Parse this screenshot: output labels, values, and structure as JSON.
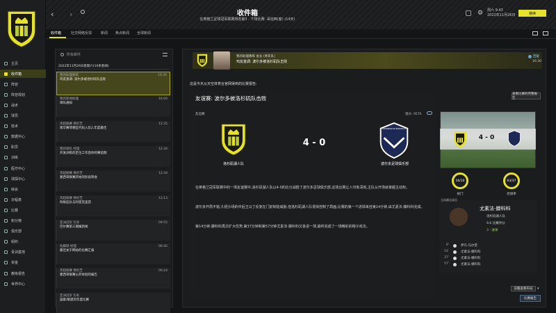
{
  "colors": {
    "accent": "#e6e22b",
    "bg": "#141516",
    "panel": "#1b1c1d"
  },
  "header": {
    "title": "收件箱",
    "subtitle": "在英格兰足球冠军联赛排名第3 - 下场比赛: 哥廷西(客) (14天)",
    "date_line1": "周六 9:43",
    "date_line2": "2022年11月26日",
    "continue_label": "继续"
  },
  "nav": {
    "items": [
      {
        "label": "主页",
        "icon": "home-icon"
      },
      {
        "label": "收件箱",
        "icon": "inbox-icon"
      },
      {
        "label": "阵容",
        "icon": "squad-icon"
      },
      {
        "label": "阵容规划",
        "icon": "planner-icon"
      },
      {
        "label": "战术",
        "icon": "tactics-icon"
      },
      {
        "label": "球员",
        "icon": "players-icon"
      },
      {
        "label": "技术",
        "icon": "tech-icon"
      },
      {
        "label": "数据中心",
        "icon": "data-icon"
      },
      {
        "label": "职员",
        "icon": "staff-icon"
      },
      {
        "label": "训练",
        "icon": "training-icon"
      },
      {
        "label": "医疗中心",
        "icon": "medical-icon"
      },
      {
        "label": "球探中心",
        "icon": "scouting-icon"
      },
      {
        "label": "转会",
        "icon": "transfer-icon"
      },
      {
        "label": "日程表",
        "icon": "calendar-icon"
      },
      {
        "label": "比赛",
        "icon": "match-icon"
      },
      {
        "label": "积分榜",
        "icon": "table-icon"
      },
      {
        "label": "俱乐部",
        "icon": "club-icon"
      },
      {
        "label": "组织",
        "icon": "org-icon"
      },
      {
        "label": "青训基地",
        "icon": "youth-icon"
      },
      {
        "label": "资金",
        "icon": "finance-icon"
      },
      {
        "label": "教练报告",
        "icon": "report-icon"
      },
      {
        "label": "世界中心",
        "icon": "world-icon"
      }
    ]
  },
  "tabs": [
    {
      "label": "收件箱"
    },
    {
      "label": "社交网络反馈"
    },
    {
      "label": "新闻"
    },
    {
      "label": "焦点新闻"
    },
    {
      "label": "全球新闻"
    }
  ],
  "inbox": {
    "search_placeholder": "所有邮件",
    "group_label": "2022年11月26日星期六(10条新闻)",
    "messages": [
      {
        "from": "我的助理教练",
        "time": "16:30",
        "subject": "鸡友富调: 波尔多被洛杉矶队击败"
      },
      {
        "from": "我的新闻助理",
        "time": "16:00",
        "subject": "球队通知"
      },
      {
        "from": "英超联赛 佛伦芝",
        "time": "12:35",
        "subject": "南华赛菲哪些代码入队2,年度最佳"
      },
      {
        "from": "我的球队 经理",
        "time": "12:34",
        "subject": "开发训练的定位工作后你的赛前期"
      },
      {
        "from": "英超联赛 佛伦芝",
        "time": "12:34",
        "subject": "墨西哥联赛开始的阶段转会"
      },
      {
        "from": "英超联赛 佛伦芝",
        "time": "12:13",
        "subject": "阿根廷队与阿密克里昂"
      },
      {
        "from": "亚洲冠军 包冬",
        "time": "09:55",
        "subject": "巴尔赛第三期报新闻"
      },
      {
        "from": "佐藤刚 经理",
        "time": "06:45",
        "subject": "最佳关于网站的比赛汇报"
      },
      {
        "from": "英超联赛 佛伦芝",
        "time": "06:24",
        "subject": "墨西哥联赛公开体验的报告"
      },
      {
        "from": "亚洲冠军 包冬",
        "time": "",
        "subject": "国家/联盟的年度比赛"
      }
    ]
  },
  "detail": {
    "head_from": "我的助理教练 会长 (青年队)",
    "head_subject": "鸡友富调: 波尔多被洛杉矶队击败",
    "reply_label": "回复",
    "time": "16:30",
    "intro": "这是今天从天空体育台官网得到的比赛报告:",
    "title": "友谊赛: 波尔多被洛杉矶队击败",
    "competition": "友谊赛",
    "attendance": "观众: 9570",
    "home_team": "洛杉矶湖人队",
    "away_team": "波尔多足球俱乐部",
    "score": "4 - 0",
    "away_badge_text": "GIRONDINS DE BORDEAUX",
    "view_full_label": "查看比赛的完整报告",
    "paragraphs": [
      "在英格兰冠军联赛中的一场友谊赛中,洛杉矶湖人队以4-0的比分战胜了波尔多足球俱乐部,这场比赛让人印象深刻,主队从开场就掌握主动权。",
      "波尔多开局不错,久经沙场的中后卫马丁反复在门前制造威胁,但洛杉矶湖人队很快控制了局面,比赛的第一个进球来自第14分钟,由尤素法-滕科科完成。",
      "第14分钟,滕科科再次扩大优势,第37分钟和第57分钟尤素法-滕科科又各进一球,最终完成了一场精彩的帽子戏法。"
    ],
    "ring1_value": "16/10",
    "ring1_label": "射门",
    "ring2_value": "63/37",
    "ring2_label": "控球率",
    "player_section_label": "当场最佳球员",
    "player_name": "尤素法-滕科科",
    "player_team": "洛杉矶湖人队",
    "player_rating": "9.6 比赛评分",
    "player_flag": "3 - 进球",
    "goals": [
      {
        "min": "9'",
        "name": "伊凡·马尔堡"
      },
      {
        "min": "14'",
        "name": "尤素法-滕科科"
      },
      {
        "min": "37'",
        "name": "尤素法-滕科科"
      },
      {
        "min": "57'",
        "name": "尤素法-滕科科"
      }
    ],
    "footer_dropdown": "前瞻查看布局",
    "footer_button": "比赛报告"
  }
}
